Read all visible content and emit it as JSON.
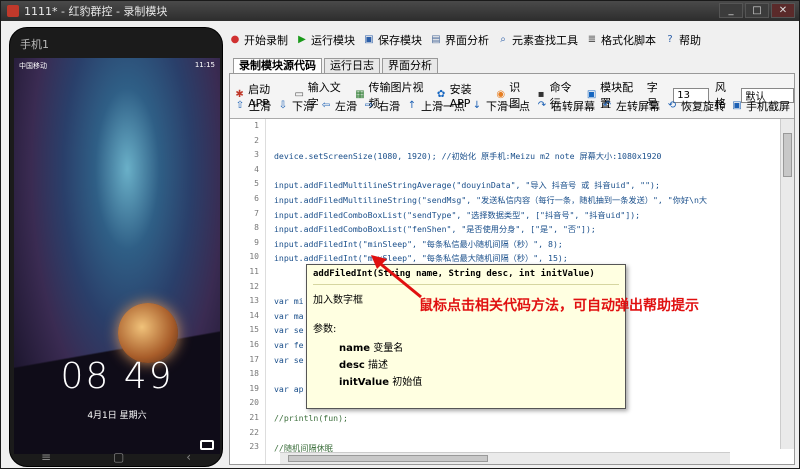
{
  "window": {
    "title": "1111* - 红豹群控 - 录制模块"
  },
  "phone": {
    "name": "手机1",
    "carrier": "中国移动",
    "status_right": "11:15",
    "time": "08 49",
    "date": "4月1日 星期六"
  },
  "toolbar": [
    {
      "label": "开始录制",
      "icon": "record-icon",
      "color": "#d03030"
    },
    {
      "label": "运行模块",
      "icon": "play-icon",
      "color": "#1a9a1a"
    },
    {
      "label": "保存模块",
      "icon": "save-icon",
      "color": "#2b5ea8"
    },
    {
      "label": "界面分析",
      "icon": "window-icon",
      "color": "#4a6a9a"
    },
    {
      "label": "元素查找工具",
      "icon": "search-icon",
      "color": "#2b5ea8"
    },
    {
      "label": "格式化脚本",
      "icon": "format-icon",
      "color": "#444444"
    },
    {
      "label": "帮助",
      "icon": "help-icon",
      "color": "#2b5ea8"
    }
  ],
  "tabs": [
    "录制模块源代码",
    "运行日志",
    "界面分析"
  ],
  "actions_row1": [
    "启动APP",
    "输入文字",
    "传输图片视频",
    "安装APP",
    "识图",
    "命令行",
    "模块配置"
  ],
  "font_label": "字号",
  "font_size": "13",
  "style_label": "风格",
  "style_value": "默认",
  "actions_row2": [
    "上滑",
    "下滑",
    "左滑",
    "右滑",
    "上滑一点",
    "下滑一点",
    "右转屏幕",
    "左转屏幕",
    "恢复旋转",
    "手机截屏"
  ],
  "code_lines": [
    {
      "n": "1",
      "text": ""
    },
    {
      "n": "2",
      "text": ""
    },
    {
      "n": "3",
      "text": "device.setScreenSize(1080, 1920); //初始化 原手机:Meizu m2 note 屏幕大小:1080x1920"
    },
    {
      "n": "4",
      "text": ""
    },
    {
      "n": "5",
      "text": "input.addFiledMultilineStringAverage(\"douyinData\", \"导入 抖音号 或 抖音uid\", \"\");"
    },
    {
      "n": "6",
      "text": "input.addFiledMultilineString(\"sendMsg\", \"发送私信内容（每行一条，随机抽到一条发送）\", \"你好\\n大"
    },
    {
      "n": "7",
      "text": "input.addFiledComboBoxList(\"sendType\", \"选择数据类型\", [\"抖音号\", \"抖音uid\"]);"
    },
    {
      "n": "8",
      "text": "input.addFiledComboBoxList(\"fenShen\", \"是否使用分身\", [\"是\", \"否\"]);"
    },
    {
      "n": "9",
      "text": "input.addFiledInt(\"minSleep\", \"每条私信最小随机间隔（秒）\", 8);"
    },
    {
      "n": "10",
      "text": "input.addFiledInt(\"maxSleep\", \"每条私信最大随机间隔（秒）\", 15);"
    },
    {
      "n": "11",
      "text": ""
    },
    {
      "n": "12",
      "text": ""
    },
    {
      "n": "13",
      "text": "var mi"
    },
    {
      "n": "14",
      "text": "var ma"
    },
    {
      "n": "15",
      "text": "var se"
    },
    {
      "n": "16",
      "text": "var fe"
    },
    {
      "n": "17",
      "text": "var se"
    },
    {
      "n": "18",
      "text": ""
    },
    {
      "n": "19",
      "text": "var ap"
    },
    {
      "n": "20",
      "text": ""
    },
    {
      "n": "21",
      "text": "//println(fun);"
    },
    {
      "n": "22",
      "text": ""
    },
    {
      "n": "23",
      "text": "//随机间隔休眠"
    }
  ],
  "tooltip": {
    "signature": "addFiledInt(String name, String desc, int initValue)",
    "desc": "加入数字框",
    "params_title": "参数:",
    "params": [
      {
        "name": "name",
        "desc": "变量名"
      },
      {
        "name": "desc",
        "desc": "描述"
      },
      {
        "name": "initValue",
        "desc": "初始值"
      }
    ]
  },
  "annotation": "鼠标点击相关代码方法，可自动弹出帮助提示",
  "colors": {
    "accent": "#e01010",
    "tooltip_bg": "#ffffe1"
  }
}
